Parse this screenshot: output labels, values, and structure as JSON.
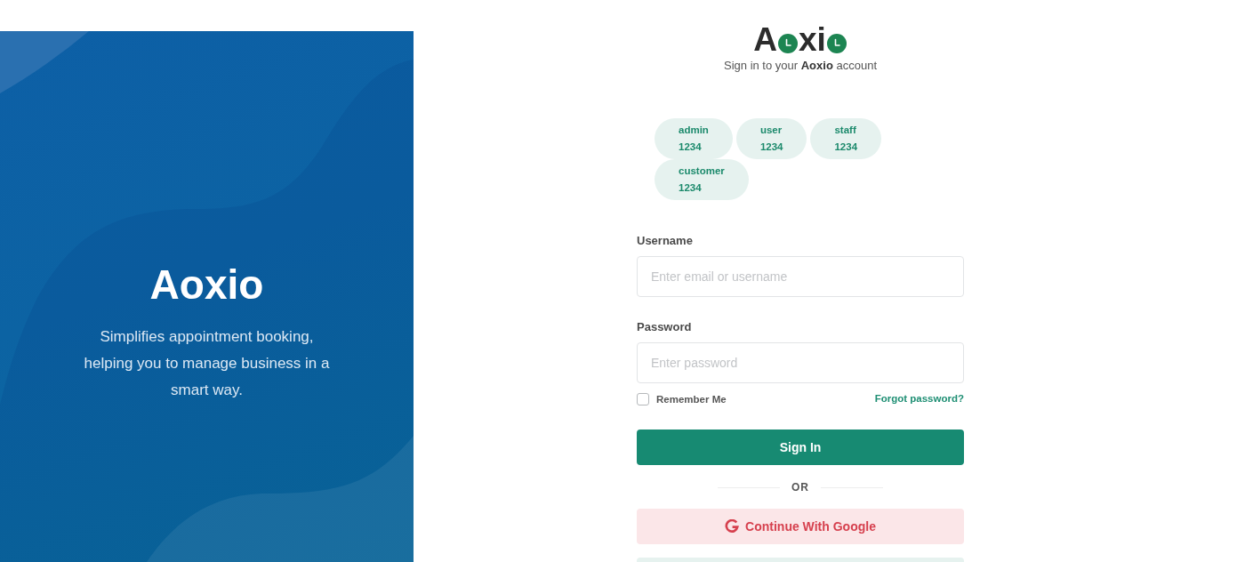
{
  "hero": {
    "title": "Aoxio",
    "tagline": "Simplifies appointment booking, helping you to manage business in a smart way."
  },
  "logo": {
    "parts": [
      {
        "kind": "text",
        "text": "A"
      },
      {
        "kind": "clock"
      },
      {
        "kind": "text",
        "text": "xi"
      },
      {
        "kind": "clock"
      }
    ]
  },
  "subtitle": "Sign in to your **Aoxio** account",
  "demo_accounts": [
    {
      "username": "admin",
      "password": "1234"
    },
    {
      "username": "user",
      "password": "1234"
    },
    {
      "username": "staff",
      "password": "1234"
    },
    {
      "username": "customer",
      "password": "1234"
    }
  ],
  "fields": [
    {
      "label": "Username",
      "placeholder": "Enter email or username"
    },
    {
      "label": "Password",
      "placeholder": "Enter password"
    }
  ],
  "remember": {
    "label": "Remember Me",
    "checked": false
  },
  "forgot_link": "Forgot password?",
  "sign_in_button": "Sign In",
  "divider": "OR",
  "google_button": "Continue With Google"
}
